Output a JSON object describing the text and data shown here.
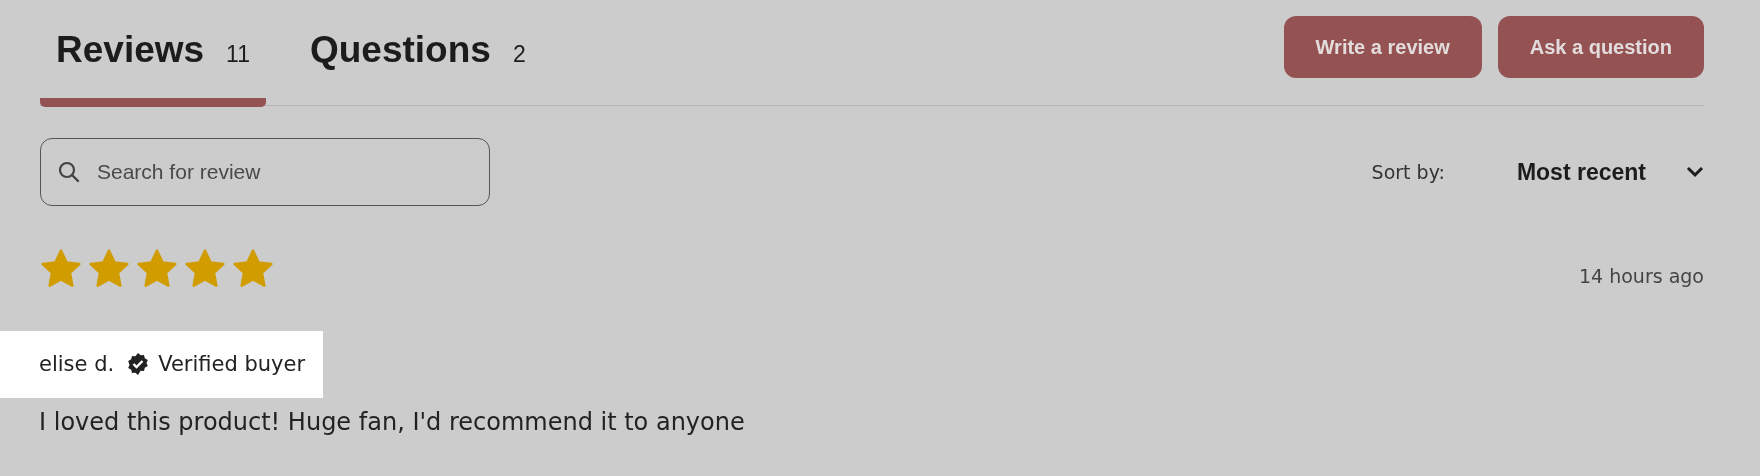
{
  "tabs": [
    {
      "label": "Reviews",
      "count": "11",
      "selected": true
    },
    {
      "label": "Questions",
      "count": "2",
      "selected": false
    }
  ],
  "buttons": [
    "Write a review",
    "Ask a question"
  ],
  "search": {
    "placeholder": "Search for review"
  },
  "sort": {
    "label": "Sort by:",
    "value": "Most recent"
  },
  "reviews": [
    {
      "stars": 5,
      "time": "14 hours ago",
      "author": "elise d.",
      "verified": "Verified buyer",
      "highlighted": true,
      "text": "I loved this product! Huge fan, I'd recommend it to anyone"
    }
  ]
}
